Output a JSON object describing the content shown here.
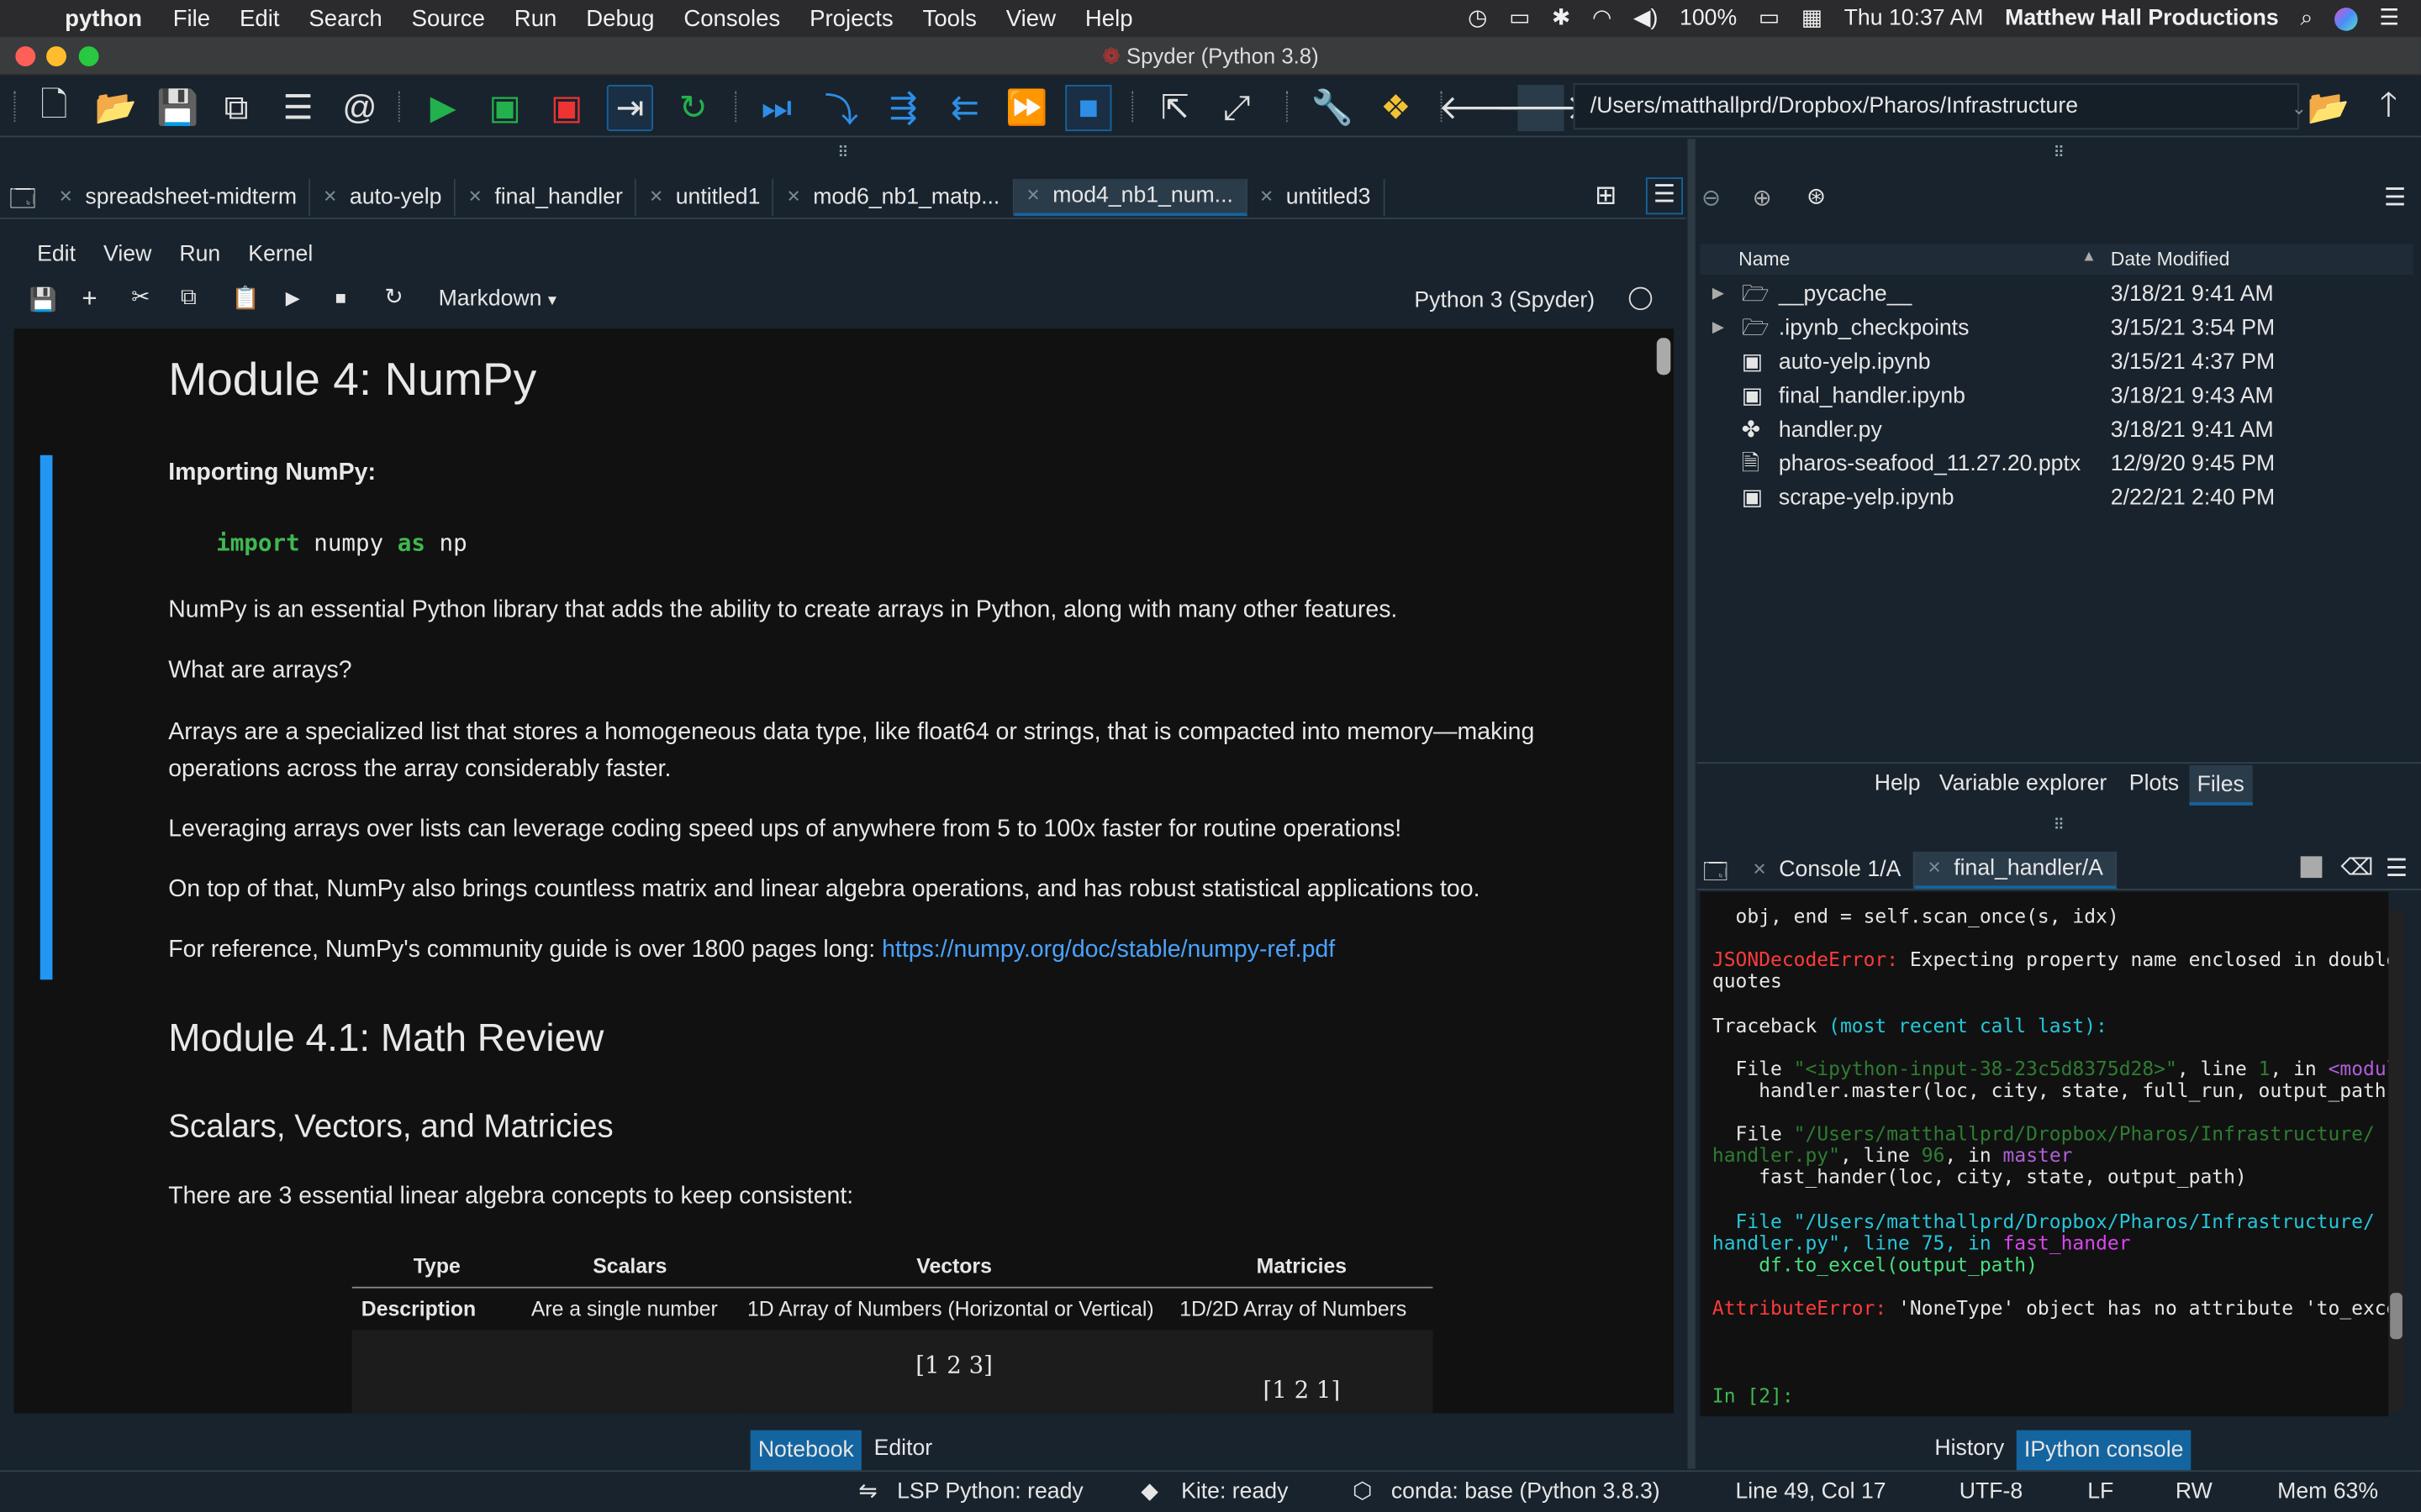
{
  "menubar": {
    "app": "python",
    "items": [
      "File",
      "Edit",
      "Search",
      "Source",
      "Run",
      "Debug",
      "Consoles",
      "Projects",
      "Tools",
      "View",
      "Help"
    ],
    "battery": "100%",
    "clock": "Thu 10:37 AM",
    "user": "Matthew Hall Productions"
  },
  "window": {
    "title": "Spyder (Python 3.8)"
  },
  "toolbar": {
    "path": "/Users/matthallprd/Dropbox/Pharos/Infrastructure"
  },
  "editor_tabs": [
    "spreadsheet-midterm",
    "auto-yelp",
    "final_handler",
    "untitled1",
    "mod6_nb1_matp...",
    "mod4_nb1_num...",
    "untitled3"
  ],
  "notebook": {
    "menu": [
      "Edit",
      "View",
      "Run",
      "Kernel"
    ],
    "cell_type": "Markdown",
    "kernel": "Python 3 (Spyder)",
    "h1": "Module 4: NumPy",
    "importing": "Importing NumPy:",
    "code": {
      "kw1": "import",
      "mod": "numpy",
      "kw2": "as",
      "alias": "np"
    },
    "p1": "NumPy is an essential Python library that adds the ability to create arrays in Python, along with many other features.",
    "p2": "What are arrays?",
    "p3a": "Arrays are a specialized list that stores a homogeneous data type, like float64 or strings, that is compacted into memory—making",
    "p3b": "operations across the array considerably faster.",
    "p4": "Leveraging arrays over lists can leverage coding speed ups of anywhere from 5 to 100x faster for routine operations!",
    "p5": "On top of that, NumPy also brings countless matrix and linear algebra operations, and has robust statistical applications too.",
    "p6": "For reference, NumPy's community guide is over 1800 pages long:",
    "link": "https://numpy.org/doc/stable/numpy-ref.pdf",
    "h2": "Module 4.1: Math Review",
    "h3": "Scalars, Vectors, and Matricies",
    "p7": "There are 3 essential linear algebra concepts to keep consistent:",
    "table": {
      "headers": [
        "Type",
        "Scalars",
        "Vectors",
        "Matricies"
      ],
      "row": [
        "Description",
        "Are a single number",
        "1D Array of Numbers (Horizontal or Vertical)",
        "1D/2D Array of Numbers"
      ],
      "vector": "[1  2  3]",
      "matrix": "⌈1  2  1⌉"
    }
  },
  "files": {
    "col_name": "Name",
    "col_date": "Date Modified",
    "rows": [
      {
        "name": "__pycache__",
        "date": "3/18/21 9:41 AM",
        "icon": "folder-icon"
      },
      {
        "name": ".ipynb_checkpoints",
        "date": "3/15/21 3:54 PM",
        "icon": "folder-icon"
      },
      {
        "name": "auto-yelp.ipynb",
        "date": "3/15/21 4:37 PM",
        "icon": "notebook-file-icon"
      },
      {
        "name": "final_handler.ipynb",
        "date": "3/18/21 9:43 AM",
        "icon": "notebook-file-icon"
      },
      {
        "name": "handler.py",
        "date": "3/18/21 9:41 AM",
        "icon": "python-file-icon"
      },
      {
        "name": "pharos-seafood_11.27.20.pptx",
        "date": "12/9/20 9:45 PM",
        "icon": "document-file-icon"
      },
      {
        "name": "scrape-yelp.ipynb",
        "date": "2/22/21 2:40 PM",
        "icon": "notebook-file-icon"
      }
    ]
  },
  "upper_right_tabs": [
    "Help",
    "Variable explorer",
    "Plots",
    "Files"
  ],
  "console_tabs": [
    "Console 1/A",
    "final_handler/A"
  ],
  "console": {
    "l1": "  obj, end = self.scan_once(s, idx)",
    "err1_name": "JSONDecodeError:",
    "err1_msg": " Expecting property name enclosed in double",
    "err1_msg2": "quotes",
    "tb": "Traceback ",
    "tb2": "(most recent call last):",
    "f1a": "  File ",
    "f1b": "\"<ipython-input-38-23c5d8375d28>\"",
    "f1c": ", line ",
    "f1d": "1",
    "f1e": ", in ",
    "f1f": "<module>",
    "f1g": "    handler.master(loc, city, state, full_run, output_path)",
    "f2a": "  File ",
    "f2b": "\"/Users/matthallprd/Dropbox/Pharos/Infrastructure/",
    "f2c": "handler.py\"",
    "f2d": ", line ",
    "f2e": "96",
    "f2f": ", in ",
    "f2g": "master",
    "f2h": "    fast_hander(loc, city, state, output_path)",
    "f3a": "  File \"/Users/matthallprd/Dropbox/Pharos/Infrastructure/",
    "f3b": "handler.py\", line 75, in ",
    "f3c": "fast_hander",
    "f3d": "    df.to_excel(output_path)",
    "err2_name": "AttributeError:",
    "err2_msg": " 'NoneType' object has no attribute 'to_excel",
    "prompt": "In [2]:"
  },
  "bottom_left_tabs": [
    "Notebook",
    "Editor"
  ],
  "bottom_right_tabs": [
    "History",
    "IPython console"
  ],
  "status": {
    "lsp": "LSP Python: ready",
    "kite": "Kite: ready",
    "conda": "conda: base (Python 3.8.3)",
    "pos": "Line 49, Col 17",
    "enc": "UTF-8",
    "eol": "LF",
    "rw": "RW",
    "mem": "Mem 63%"
  },
  "colors": {
    "accent": "#1464a0",
    "error": "#ff3b3b",
    "green_keyword": "#3fb950",
    "link": "#4aa3ff"
  }
}
